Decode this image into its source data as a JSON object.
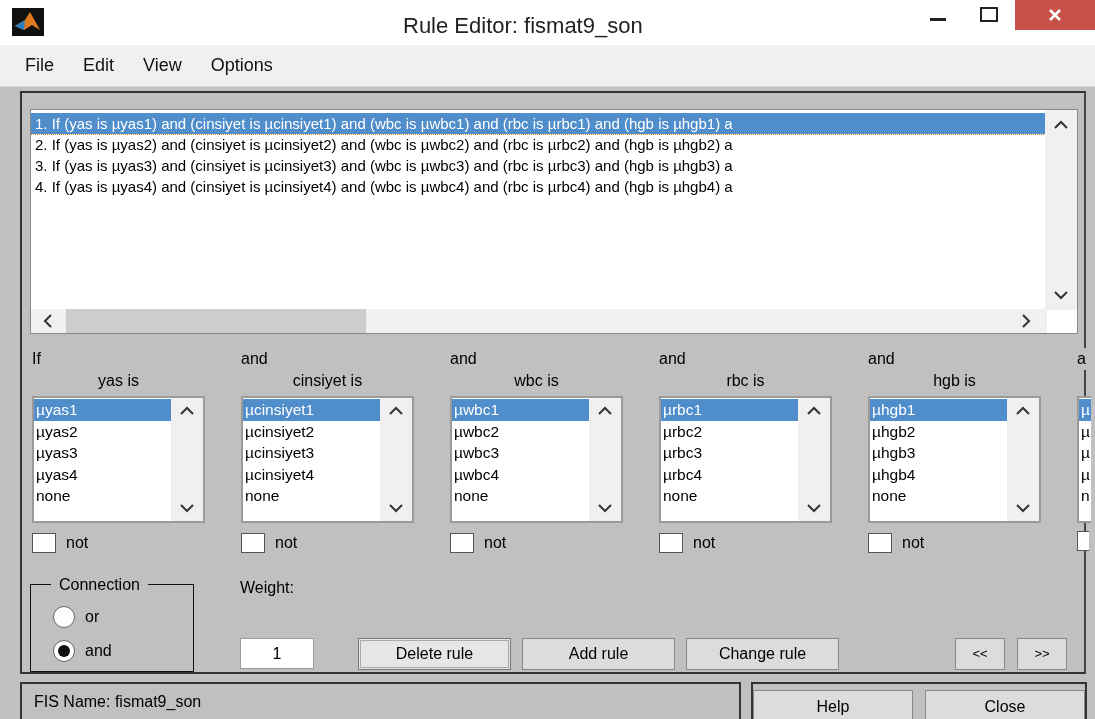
{
  "window": {
    "title": "Rule Editor: fismat9_son"
  },
  "menu": [
    "File",
    "Edit",
    "View",
    "Options"
  ],
  "rules": [
    {
      "text": "1. If (yas is µyas1) and (cinsiyet is µcinsiyet1) and (wbc is µwbc1) and (rbc is µrbc1) and (hgb is µhgb1) a",
      "selected": true
    },
    {
      "text": "2. If (yas is µyas2) and (cinsiyet is µcinsiyet2) and (wbc is µwbc2) and (rbc is µrbc2) and (hgb is µhgb2) a",
      "selected": false
    },
    {
      "text": "3. If (yas is µyas3) and (cinsiyet is µcinsiyet3) and (wbc is µwbc3) and (rbc is µrbc3) and (hgb is µhgb3) a",
      "selected": false
    },
    {
      "text": "4. If (yas is µyas4) and (cinsiyet is µcinsiyet4) and (wbc is µwbc4) and (rbc is µrbc4) and (hgb is µhgb4) a",
      "selected": false
    }
  ],
  "inputs": [
    {
      "connector": "If",
      "label": "yas is",
      "not_label": "not",
      "not": false,
      "options": [
        {
          "text": "µyas1",
          "selected": true
        },
        {
          "text": "µyas2",
          "selected": false
        },
        {
          "text": "µyas3",
          "selected": false
        },
        {
          "text": "µyas4",
          "selected": false
        },
        {
          "text": "none",
          "selected": false
        }
      ]
    },
    {
      "connector": "and",
      "label": "cinsiyet is",
      "not_label": "not",
      "not": false,
      "options": [
        {
          "text": "µcinsiyet1",
          "selected": true
        },
        {
          "text": "µcinsiyet2",
          "selected": false
        },
        {
          "text": "µcinsiyet3",
          "selected": false
        },
        {
          "text": "µcinsiyet4",
          "selected": false
        },
        {
          "text": "none",
          "selected": false
        }
      ]
    },
    {
      "connector": "and",
      "label": "wbc is",
      "not_label": "not",
      "not": false,
      "options": [
        {
          "text": "µwbc1",
          "selected": true
        },
        {
          "text": "µwbc2",
          "selected": false
        },
        {
          "text": "µwbc3",
          "selected": false
        },
        {
          "text": "µwbc4",
          "selected": false
        },
        {
          "text": "none",
          "selected": false
        }
      ]
    },
    {
      "connector": "and",
      "label": "rbc is",
      "not_label": "not",
      "not": false,
      "options": [
        {
          "text": "µrbc1",
          "selected": true
        },
        {
          "text": "µrbc2",
          "selected": false
        },
        {
          "text": "µrbc3",
          "selected": false
        },
        {
          "text": "µrbc4",
          "selected": false
        },
        {
          "text": "none",
          "selected": false
        }
      ]
    },
    {
      "connector": "and",
      "label": "hgb is",
      "not_label": "not",
      "not": false,
      "options": [
        {
          "text": "µhgb1",
          "selected": true
        },
        {
          "text": "µhgb2",
          "selected": false
        },
        {
          "text": "µhgb3",
          "selected": false
        },
        {
          "text": "µhgb4",
          "selected": false
        },
        {
          "text": "none",
          "selected": false
        }
      ]
    },
    {
      "connector": "a",
      "not": false,
      "options": [
        {
          "text": "µ",
          "selected": true
        },
        {
          "text": "µ",
          "selected": false
        },
        {
          "text": "µ",
          "selected": false
        },
        {
          "text": "µ",
          "selected": false
        },
        {
          "text": "n",
          "selected": false
        }
      ]
    }
  ],
  "connection": {
    "title": "Connection",
    "options": [
      {
        "label": "or",
        "selected": false
      },
      {
        "label": "and",
        "selected": true
      }
    ]
  },
  "weight": {
    "label": "Weight:",
    "value": "1"
  },
  "buttons": [
    "Delete rule",
    "Add rule",
    "Change rule"
  ],
  "nav_buttons": [
    "<<",
    ">>"
  ],
  "status": "FIS Name: fismat9_son",
  "footer_buttons": [
    "Help",
    "Close"
  ]
}
